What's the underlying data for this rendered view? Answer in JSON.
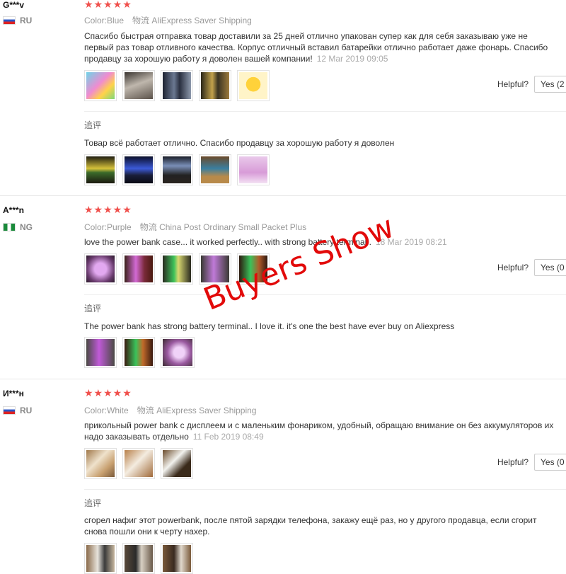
{
  "reviews": [
    {
      "user": "G***v",
      "country": "RU",
      "stars": "★★★★★",
      "color_label": "Color:",
      "color_value": "Blue",
      "shipping_label": "物流",
      "shipping_value": "AliExpress Saver Shipping",
      "text": "Спасибо быстрая отправка товар доставили за 25 дней отлично упакован супер как для себя заказываю уже не первый раз товар отливного качества. Корпус отличный вставил батарейки отлично работает даже фонарь. Спасибо продавцу за хорошую работу я доволен вашей компании!",
      "date": "12 Mar 2019 09:05",
      "helpful_label": "Helpful?",
      "yes_label": "Yes (2",
      "followup_label": "追评",
      "followup_text": "Товар всё работает отлично. Спасибо продавцу за хорошую работу я доволен"
    },
    {
      "user": "A***n",
      "country": "NG",
      "stars": "★★★★★",
      "color_label": "Color:",
      "color_value": "Purple",
      "shipping_label": "物流",
      "shipping_value": "China Post Ordinary Small Packet Plus",
      "text": "love the power bank case... it worked perfectly.. with strong battery terminal..",
      "date": "18 Mar 2019 08:21",
      "helpful_label": "Helpful?",
      "yes_label": "Yes (0",
      "followup_label": "追评",
      "followup_text": "The power bank has strong battery terminal.. I love it. it's one the best have ever buy on Aliexpress"
    },
    {
      "user": "И***н",
      "country": "RU",
      "stars": "★★★★★",
      "color_label": "Color:",
      "color_value": "White",
      "shipping_label": "物流",
      "shipping_value": "AliExpress Saver Shipping",
      "text": "прикольный power bank с дисплеем и с маленьким фонариком, удобный, обращаю внимание он без аккумуляторов их надо заказывать отдельно",
      "date": "11 Feb 2019 08:49",
      "helpful_label": "Helpful?",
      "yes_label": "Yes (0",
      "followup_label": "追评",
      "followup_text": "сгорел нафиг этот powerbank, после пятой зарядки телефона, закажу ещё раз, но у другого продавца, если сгорит снова пошли они к черту нахер."
    }
  ],
  "overlay_text": "Buyers Show",
  "colors": {
    "star": "#f0504c",
    "overlay": "#e20a0a"
  }
}
